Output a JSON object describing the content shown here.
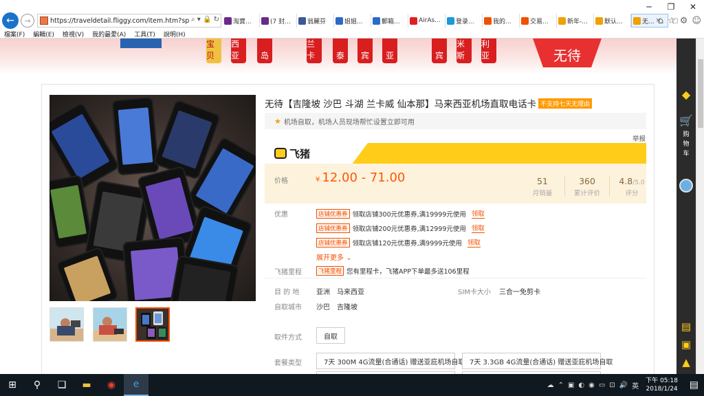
{
  "browser": {
    "url": "https://traveldetail.fliggy.com/item.htm?spm=a",
    "tabs": [
      {
        "label": "淘寶...",
        "color": "#6a2a8c"
      },
      {
        "label": "(7 封...",
        "color": "#6a2a8c"
      },
      {
        "label": "翁麗芬",
        "color": "#3b5998"
      },
      {
        "label": "姐姐...",
        "color": "#2a6acb"
      },
      {
        "label": "郵箱...",
        "color": "#2a6acb"
      },
      {
        "label": "AirAs...",
        "color": "#e02020"
      },
      {
        "label": "登录...",
        "color": "#1a9ad6"
      },
      {
        "label": "我的...",
        "color": "#f25000"
      },
      {
        "label": "交易...",
        "color": "#f25000"
      },
      {
        "label": "新年-...",
        "color": "#f0a000"
      },
      {
        "label": "默认...",
        "color": "#f0a000"
      },
      {
        "label": "无...",
        "color": "#f0a000",
        "active": true
      }
    ],
    "menu": [
      "檔案(F)",
      "編輯(E)",
      "檢視(V)",
      "我的最愛(A)",
      "工具(T)",
      "說明(H)"
    ]
  },
  "banner": {
    "tiles": [
      "宝贝",
      "西亚",
      "岛",
      "兰卡",
      "泰",
      "宾",
      "亚",
      "宾",
      "米斯",
      "利亚"
    ],
    "tag": "无待"
  },
  "product": {
    "title": "无待【吉隆坡 沙巴 斗湖 兰卡威 仙本那】马来西亚机场直取电话卡",
    "title_tag": "不支持七天无理由",
    "subtitle": "机场自取，机场人员现场帮忙设置立即可用",
    "report": "举报",
    "brand": "飞猪",
    "price_label": "价格",
    "currency": "¥",
    "price": "12.00 - 71.00",
    "stats": [
      {
        "value": "51",
        "label": "月销量"
      },
      {
        "value": "360",
        "label": "累计评价"
      },
      {
        "value": "4.8",
        "sub": "/5.0",
        "label": "评分"
      }
    ],
    "promo_label": "优惠",
    "promos": [
      {
        "tag": "店铺优惠券",
        "text": "领取店铺300元优惠券,满19999元使用",
        "action": "领取"
      },
      {
        "tag": "店铺优惠券",
        "text": "领取店铺200元优惠券,满12999元使用",
        "action": "领取"
      },
      {
        "tag": "店铺优惠券",
        "text": "领取店铺120元优惠券,满9999元使用",
        "action": "领取"
      }
    ],
    "more": "展开更多",
    "mileage_label": "飞猪里程",
    "mileage_tag": "飞猪里程",
    "mileage_text": "您有里程卡，飞猪APP下单最多送106里程",
    "destination_label": "目 的 地",
    "destination": "亚洲　马来西亚",
    "sim_label": "SIM卡大小",
    "sim_value": "三合一免剪卡",
    "city_label": "自取城市",
    "city_value": "沙巴　吉隆坡",
    "pickup_label": "取件方式",
    "pickup_option": "自取",
    "package_label": "套餐类型",
    "packages": [
      "7天 300M 4G流量(合通话) 赠送亚庇机场自取",
      "7天 3.3GB 4G流量(合通话) 赠送亚庇机场自取"
    ]
  },
  "sidebar": {
    "cart_label": "购物车"
  },
  "taskbar": {
    "time_period": "下午",
    "time": "05:18",
    "date": "2018/1/24"
  }
}
